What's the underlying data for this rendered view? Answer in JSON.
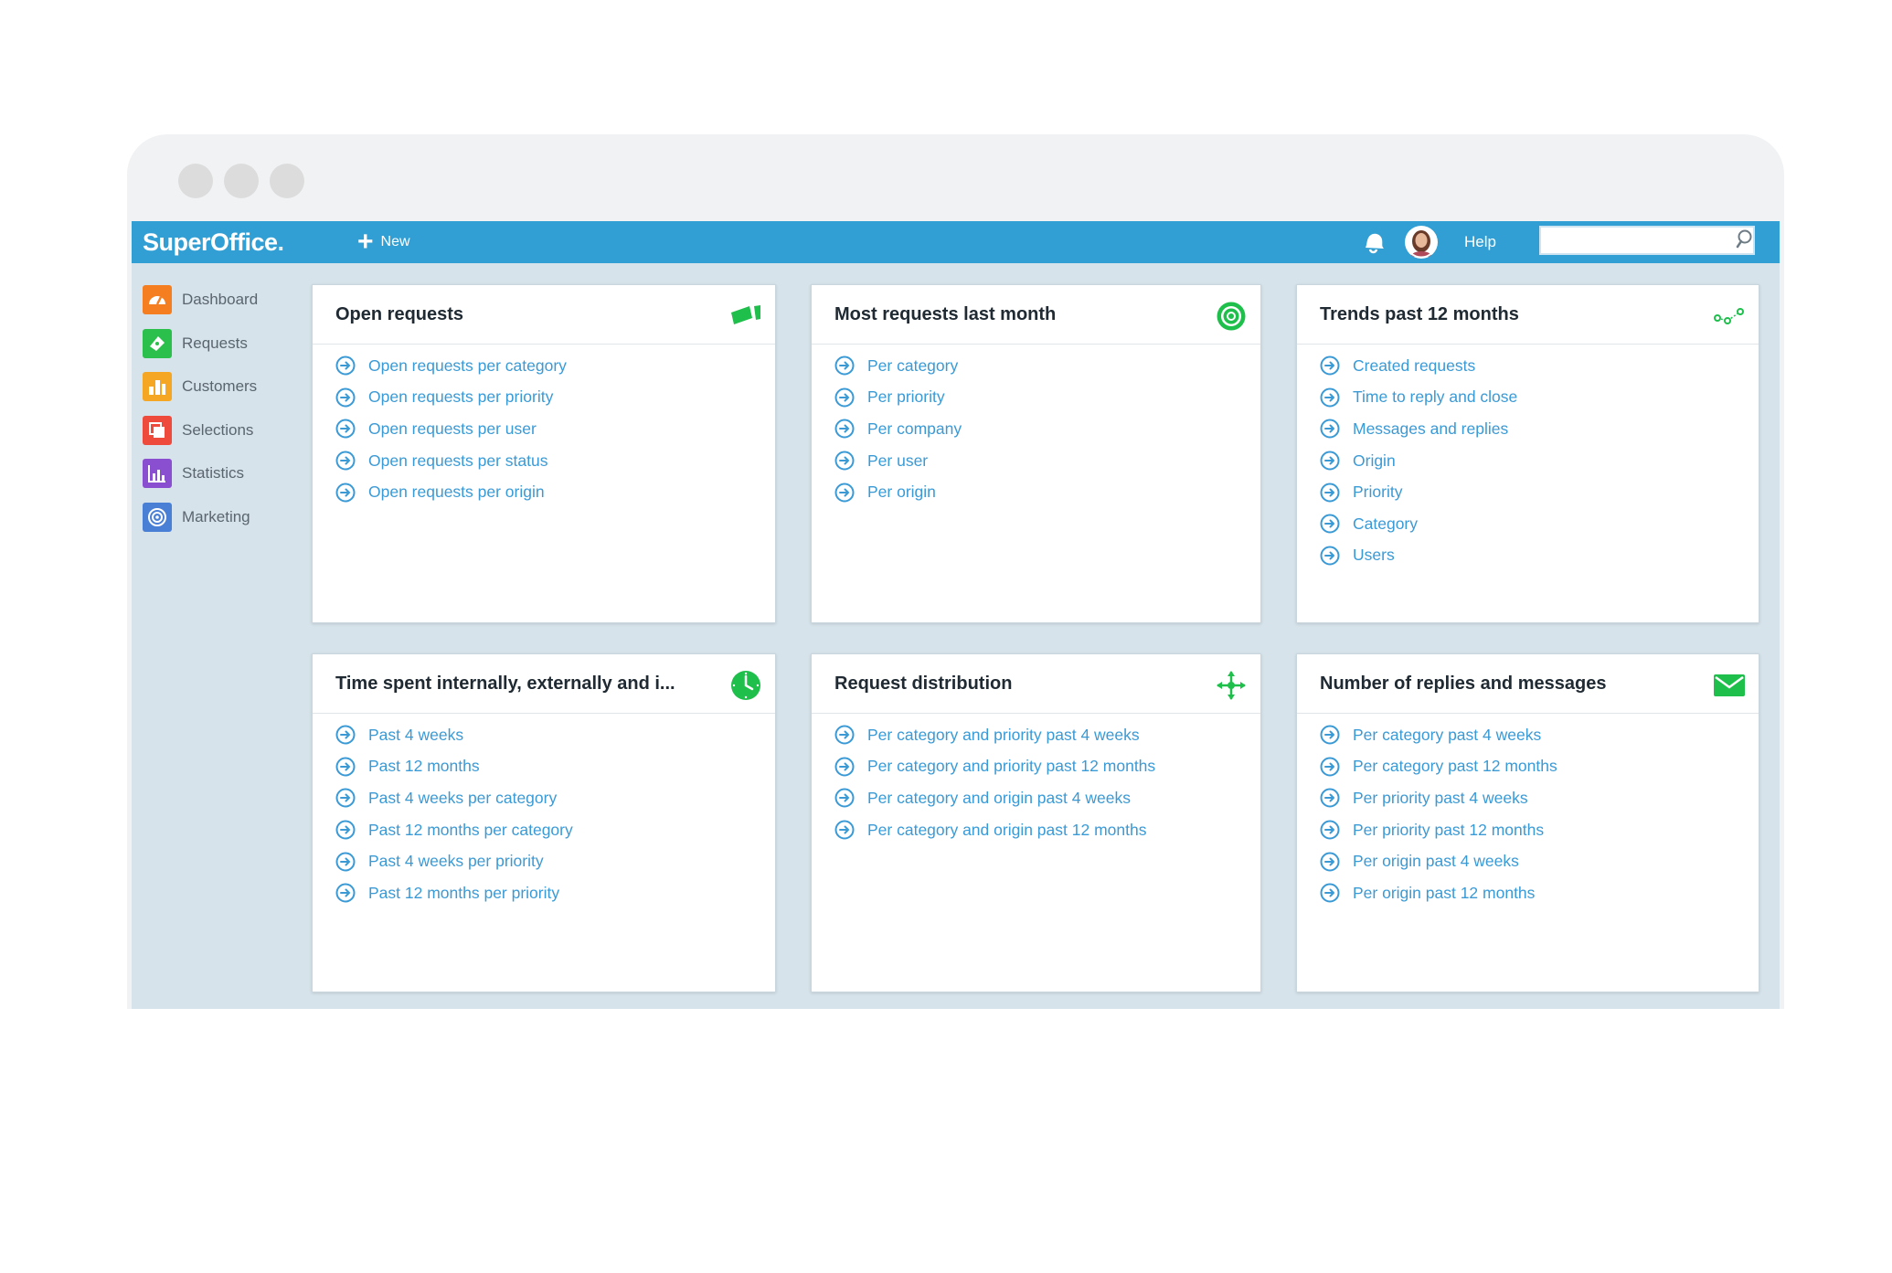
{
  "app": {
    "logo": "SuperOffice",
    "logo_dot": "."
  },
  "topbar": {
    "new_label": "New",
    "help_label": "Help",
    "search_value": "",
    "search_placeholder": ""
  },
  "colors": {
    "brand": "#319fd3",
    "link": "#3a9ad6",
    "accent_green": "#1fbf4c"
  },
  "sidebar": {
    "items": [
      {
        "label": "Dashboard",
        "icon": "dashboard-icon",
        "color": "#f47e20"
      },
      {
        "label": "Requests",
        "icon": "ticket-icon",
        "color": "#2bbf4b"
      },
      {
        "label": "Customers",
        "icon": "customers-icon",
        "color": "#f5a623"
      },
      {
        "label": "Selections",
        "icon": "selections-icon",
        "color": "#ef4b3c"
      },
      {
        "label": "Statistics",
        "icon": "statistics-icon",
        "color": "#8a4fd1"
      },
      {
        "label": "Marketing",
        "icon": "marketing-icon",
        "color": "#4a7fd6"
      }
    ]
  },
  "cards": [
    {
      "title": "Open requests",
      "icon": "tickets-icon",
      "links": [
        "Open requests per category",
        "Open requests per priority",
        "Open requests per user",
        "Open requests per status",
        "Open requests per origin"
      ]
    },
    {
      "title": "Most requests last month",
      "icon": "target-icon",
      "links": [
        "Per category",
        "Per priority",
        "Per company",
        "Per user",
        "Per origin"
      ]
    },
    {
      "title": "Trends past 12 months",
      "icon": "trend-icon",
      "links": [
        "Created requests",
        "Time to reply and close",
        "Messages and replies",
        "Origin",
        "Priority",
        "Category",
        "Users"
      ]
    },
    {
      "title": "Time spent internally, externally and i...",
      "icon": "clock-icon",
      "links": [
        "Past 4 weeks",
        "Past 12 months",
        "Past 4 weeks per category",
        "Past 12 months per category",
        "Past 4 weeks per priority",
        "Past 12 months per priority"
      ]
    },
    {
      "title": "Request distribution",
      "icon": "distribution-icon",
      "links": [
        "Per category and priority past 4 weeks",
        "Per category and priority past 12 months",
        "Per category and origin past 4 weeks",
        "Per category and origin past 12 months"
      ]
    },
    {
      "title": "Number of replies and messages",
      "icon": "envelope-icon",
      "links": [
        "Per category past 4 weeks",
        "Per category past 12 months",
        "Per priority past 4 weeks",
        "Per priority past 12 months",
        "Per origin past 4 weeks",
        "Per origin past 12 months"
      ]
    }
  ]
}
